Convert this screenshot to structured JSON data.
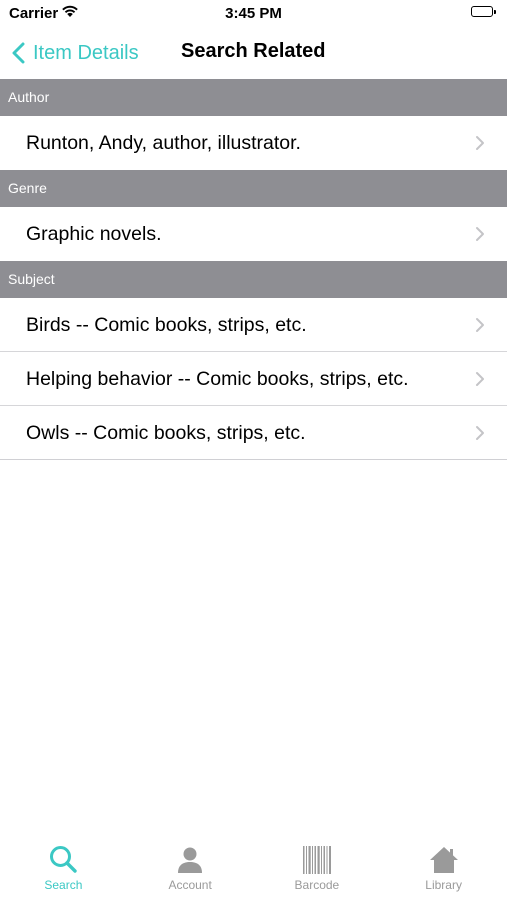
{
  "status_bar": {
    "carrier": "Carrier",
    "time": "3:45 PM"
  },
  "nav": {
    "back_label": "Item Details",
    "title": "Search Related"
  },
  "sections": [
    {
      "header": "Author",
      "rows": [
        "Runton, Andy, author, illustrator."
      ]
    },
    {
      "header": "Genre",
      "rows": [
        "Graphic novels."
      ]
    },
    {
      "header": "Subject",
      "rows": [
        "Birds -- Comic books, strips, etc.",
        "Helping behavior -- Comic books, strips, etc.",
        "Owls -- Comic books, strips, etc."
      ]
    }
  ],
  "tabs": [
    {
      "label": "Search",
      "icon": "search-icon",
      "active": true
    },
    {
      "label": "Account",
      "icon": "person-icon",
      "active": false
    },
    {
      "label": "Barcode",
      "icon": "barcode-icon",
      "active": false
    },
    {
      "label": "Library",
      "icon": "house-icon",
      "active": false
    }
  ],
  "colors": {
    "accent": "#3bc8c4",
    "section_header": "#8e8e93",
    "tab_inactive": "#9a9a9a"
  }
}
